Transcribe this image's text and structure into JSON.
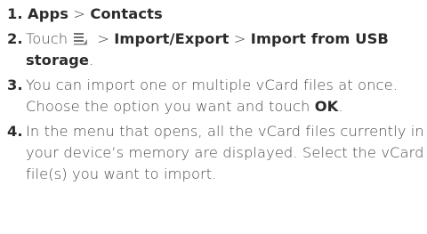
{
  "steps": [
    {
      "number": "1.",
      "app": "Apps",
      "sep": ">",
      "target": "Contacts"
    },
    {
      "number": "2.",
      "touch": "Touch",
      "icon": "menu-icon",
      "sep1": ">",
      "item1": "Import/Export",
      "sep2": ">",
      "item2_line1": "Import from USB",
      "item2_line2": "storage",
      "period": "."
    },
    {
      "number": "3.",
      "text": "You can import one or multiple vCard files at once. Choose the option you want and touch",
      "ok": "OK",
      "period": "."
    },
    {
      "number": "4.",
      "text": "In the menu that opens, all the vCard files currently in your device’s memory are displayed. Select the vCard file(s) you want to import."
    }
  ]
}
